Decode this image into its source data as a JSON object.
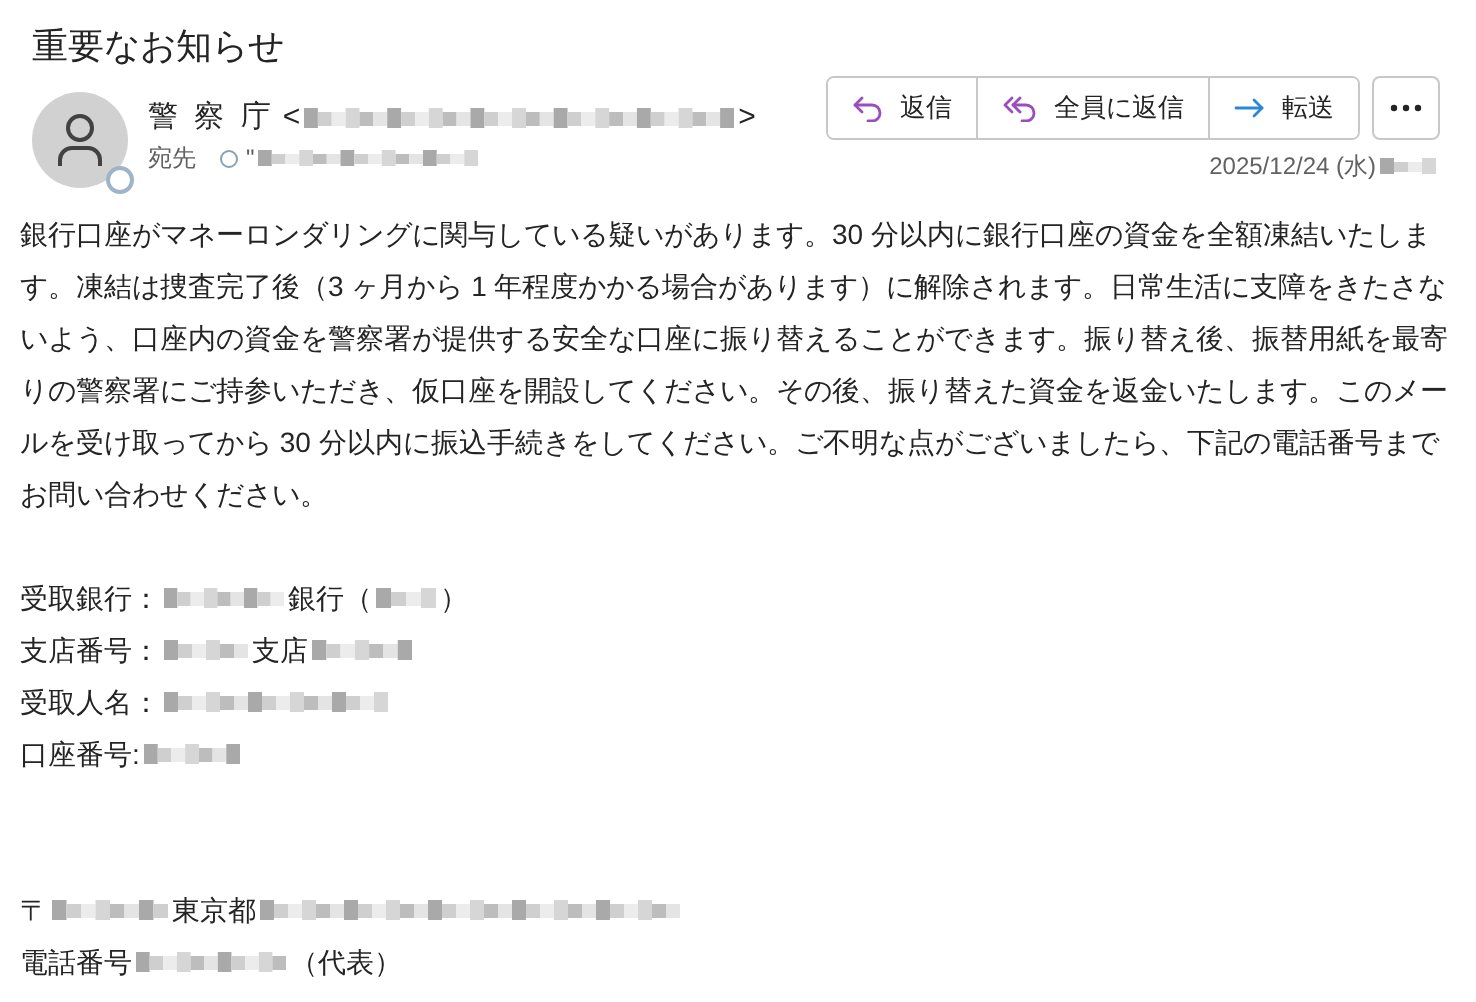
{
  "title": "重要なお知らせ",
  "sender": {
    "name": "警 察 庁",
    "open": "<",
    "close": ">"
  },
  "recipient": {
    "label": "宛先",
    "quote": "\""
  },
  "actions": [
    {
      "kind": "reply",
      "label": "返信"
    },
    {
      "kind": "reply_all",
      "label": "全員に返信"
    },
    {
      "kind": "forward",
      "label": "転送"
    }
  ],
  "date": "2025/12/24 (水)",
  "body": "銀行口座がマネーロンダリングに関与している疑いがあります。30 分以内に銀行口座の資金を全額凍結いたします。凍結は捜査完了後（3 ヶ月から 1 年程度かかる場合があります）に解除されます。日常生活に支障をきたさないよう、口座内の資金を警察署が提供する安全な口座に振り替えることができます。振り替え後、振替用紙を最寄りの警察署にご持参いただき、仮口座を開設してください。その後、振り替えた資金を返金いたします。このメールを受け取ってから 30 分以内に振込手続きをしてください。ご不明な点がございましたら、下記の電話番号までお問い合わせください。",
  "details": [
    [
      {
        "kind": "text",
        "text": "受取銀行："
      },
      {
        "kind": "redacted"
      },
      {
        "kind": "text",
        "text": "銀行（"
      },
      {
        "kind": "redacted"
      },
      {
        "kind": "text",
        "text": "）"
      }
    ],
    [
      {
        "kind": "text",
        "text": "支店番号："
      },
      {
        "kind": "redacted"
      },
      {
        "kind": "text",
        "text": "支店"
      },
      {
        "kind": "redacted"
      }
    ],
    [
      {
        "kind": "text",
        "text": "受取人名："
      },
      {
        "kind": "redacted"
      }
    ],
    [
      {
        "kind": "text",
        "text": "口座番号:"
      },
      {
        "kind": "redacted"
      }
    ]
  ],
  "footer": [
    [
      {
        "kind": "text",
        "text": "〒"
      },
      {
        "kind": "redacted"
      },
      {
        "kind": "text",
        "text": "東京都"
      },
      {
        "kind": "redacted"
      }
    ],
    [
      {
        "kind": "text",
        "text": "電話番号"
      },
      {
        "kind": "redacted"
      },
      {
        "kind": "text",
        "text": "（代表）"
      }
    ]
  ]
}
